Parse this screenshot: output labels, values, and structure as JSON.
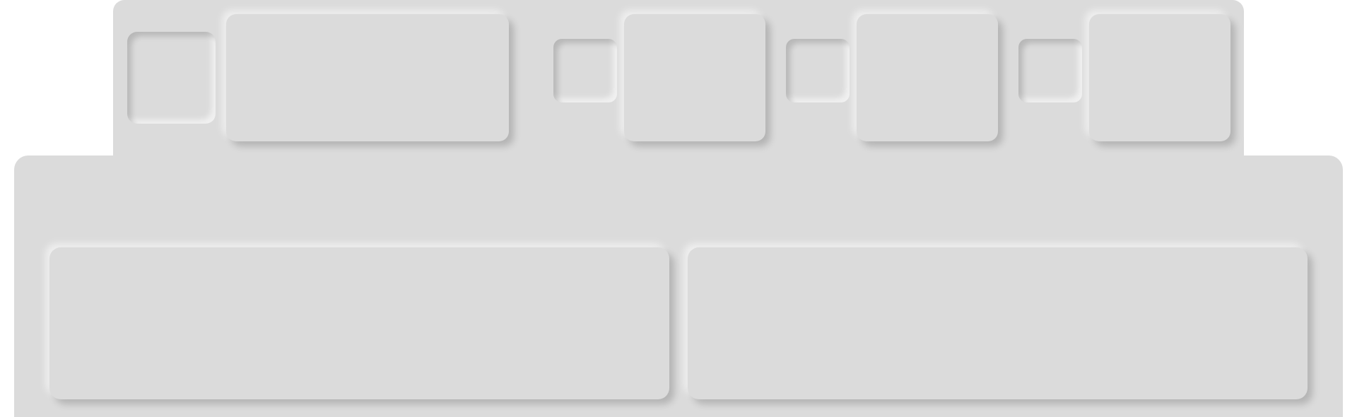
{
  "app": {
    "title": ""
  },
  "top_row": {
    "slot_1": {
      "label": ""
    },
    "card_1": {
      "label": ""
    },
    "slot_2": {
      "label": ""
    },
    "card_2": {
      "label": ""
    },
    "slot_3": {
      "label": ""
    },
    "card_3": {
      "label": ""
    },
    "slot_4": {
      "label": ""
    },
    "card_4": {
      "label": ""
    }
  },
  "bottom_row": {
    "panel_left": {
      "label": ""
    },
    "panel_right": {
      "label": ""
    }
  },
  "colors": {
    "surface": "#dbdbdb",
    "background": "#ffffff",
    "shadow_dark": "#b8b8b8",
    "shadow_light": "#f5f5f5"
  }
}
